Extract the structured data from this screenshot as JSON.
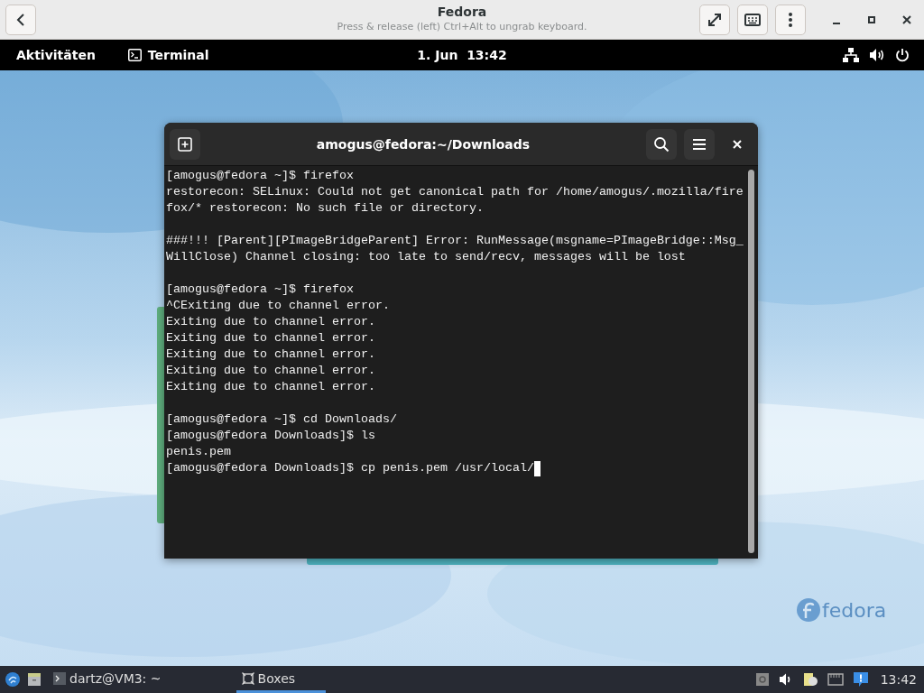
{
  "header": {
    "title": "Fedora",
    "subtitle": "Press & release (left) Ctrl+Alt to ungrab keyboard."
  },
  "top_bar": {
    "activities": "Aktivitäten",
    "app": "Terminal",
    "clock": "1. Jun  13:42"
  },
  "terminal": {
    "title": "amogus@fedora:~/Downloads",
    "cursor": true,
    "blocks": [
      [
        "[amogus@fedora ~]$ firefox",
        "restorecon: SELinux: Could not get canonical path for /home/amogus/.mozilla/fire",
        "fox/* restorecon: No such file or directory."
      ],
      [
        "###!!! [Parent][PImageBridgeParent] Error: RunMessage(msgname=PImageBridge::Msg_",
        "WillClose) Channel closing: too late to send/recv, messages will be lost"
      ],
      [
        "[amogus@fedora ~]$ firefox",
        "^CExiting due to channel error.",
        "Exiting due to channel error.",
        "Exiting due to channel error.",
        "Exiting due to channel error.",
        "Exiting due to channel error.",
        "Exiting due to channel error."
      ],
      [
        "[amogus@fedora ~]$ cd Downloads/",
        "[amogus@fedora Downloads]$ ls",
        "penis.pem",
        "[amogus@fedora Downloads]$ cp penis.pem /usr/local/"
      ]
    ]
  },
  "wallpaper": {
    "logo": "fedora"
  },
  "taskbar": {
    "tasks": [
      {
        "label": "dartz@VM3: ~",
        "selected": false
      },
      {
        "label": "Boxes",
        "selected": true
      }
    ],
    "clock": "13:42"
  }
}
